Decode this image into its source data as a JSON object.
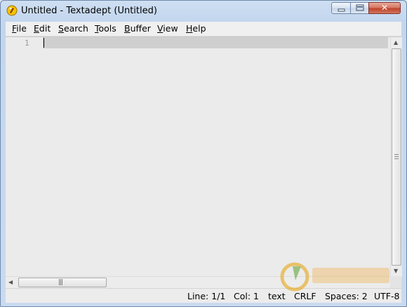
{
  "window": {
    "title": "Untitled - Textadept (Untitled)",
    "minimize_label": "",
    "maximize_label": "",
    "close_label": "✕"
  },
  "menu": [
    {
      "pre": "",
      "ul": "F",
      "post": "ile"
    },
    {
      "pre": "",
      "ul": "E",
      "post": "dit"
    },
    {
      "pre": "",
      "ul": "S",
      "post": "earch"
    },
    {
      "pre": "",
      "ul": "T",
      "post": "ools"
    },
    {
      "pre": "",
      "ul": "B",
      "post": "uffer"
    },
    {
      "pre": "",
      "ul": "V",
      "post": "iew"
    },
    {
      "pre": "",
      "ul": "H",
      "post": "elp"
    }
  ],
  "editor": {
    "line_number": "1",
    "content": ""
  },
  "status": {
    "line": "Line: 1/1",
    "col": "Col: 1",
    "lexer": "text",
    "eol": "CRLF",
    "indent": "Spaces: 2",
    "encoding": "UTF-8"
  },
  "colors": {
    "current_line": "#cfcfcf",
    "editor_bg": "#ebebeb",
    "titlebar": "#c2d6ee"
  }
}
